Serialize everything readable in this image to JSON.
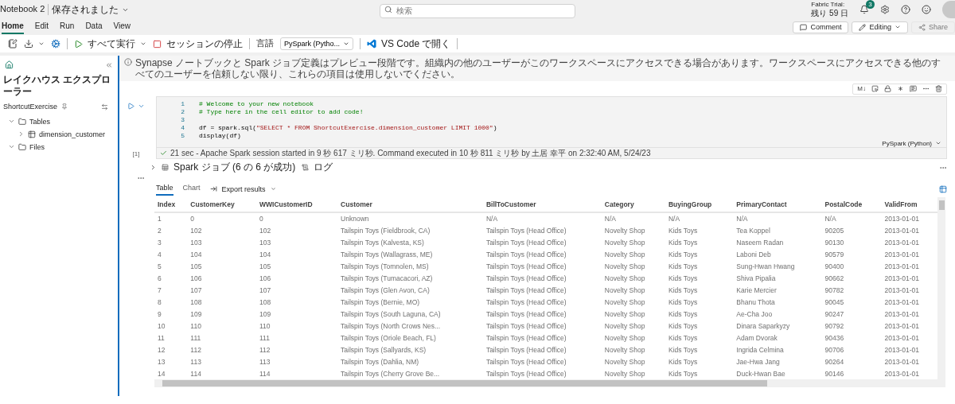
{
  "title_bar": {
    "notebook": "Notebook 2",
    "status": "保存されました",
    "search": {
      "placeholder": "検索"
    },
    "trial_label": "Fabric Trial:",
    "trial_remaining": "残り 59 日",
    "notification_count": "3"
  },
  "menu_tabs": [
    {
      "label": "Home",
      "selected": true
    },
    {
      "label": "Edit",
      "selected": false
    },
    {
      "label": "Run",
      "selected": false
    },
    {
      "label": "Data",
      "selected": false
    },
    {
      "label": "View",
      "selected": false
    }
  ],
  "actions": [
    {
      "kind": "comment",
      "label": "Comment",
      "disabled": false
    },
    {
      "kind": "editing",
      "label": "Editing",
      "disabled": false
    },
    {
      "kind": "share",
      "label": "Share",
      "disabled": true
    }
  ],
  "toolbar": {
    "run_all": "すべて実行",
    "stop_session": "セッションの停止",
    "language_label": "言語",
    "language": "PySpark (Pytho...",
    "vscode": "VS Code で開く"
  },
  "banner": "Synapse ノートブックと Spark ジョブ定義はプレビュー段階です。組織内の他のユーザーがこのワークスペースにアクセスできる場合があります。ワークスペースにアクセスできる他のすべてのユーザーを信頼しない限り、これらの項目は使用しないでください。",
  "sidebar": {
    "title": "レイクハウス エクスプローラー",
    "lakehouse": "ShortcutExercise",
    "tree": [
      {
        "kind": "folder",
        "label": "Tables",
        "expanded": true,
        "children": [
          {
            "kind": "table",
            "label": "dimension_customer",
            "expanded": false
          }
        ]
      },
      {
        "kind": "folder",
        "label": "Files",
        "expanded": true
      }
    ]
  },
  "cell": {
    "markdown_tool": "M↓",
    "lines": [
      {
        "number": "1",
        "kind": "comment",
        "code": "# Welcome to your new notebook"
      },
      {
        "number": "2",
        "kind": "comment",
        "code": "# Type here in the cell editor to add code!"
      },
      {
        "number": "3",
        "kind": "blank"
      },
      {
        "number": "4",
        "kind": "code",
        "code": "df = spark.sql(",
        "string": "\"SELECT * FROM ShortcutExercise.dimension_customer LIMIT 1000\"",
        "tail": ")"
      },
      {
        "number": "5",
        "kind": "code",
        "code": "display(df)"
      }
    ],
    "execution_count": "[1]",
    "status": "21 sec - Apache Spark session started in 9 秒 617 ミリ秒. Command executed in 10 秒 811 ミリ秒 by 土居 幸平 on 2:32:40 AM, 5/24/23",
    "language": "PySpark (Python)"
  },
  "jobs": {
    "label": "Spark ジョブ (6 の 6 が成功)",
    "log": "ログ"
  },
  "output": {
    "tabs": [
      {
        "label": "Table",
        "selected": true
      },
      {
        "label": "Chart",
        "selected": false
      }
    ],
    "export": "Export results",
    "table": {
      "columns": [
        "Index",
        "CustomerKey",
        "WWICustomerID",
        "Customer",
        "BillToCustomer",
        "Category",
        "BuyingGroup",
        "PrimaryContact",
        "PostalCode",
        "ValidFrom"
      ],
      "rows": [
        [
          "1",
          "0",
          "0",
          "Unknown",
          "N/A",
          "N/A",
          "N/A",
          "N/A",
          "N/A",
          "2013-01-01"
        ],
        [
          "2",
          "102",
          "102",
          "Tailspin Toys (Fieldbrook, CA)",
          "Tailspin Toys (Head Office)",
          "Novelty Shop",
          "Kids Toys",
          "Tea Koppel",
          "90205",
          "2013-01-01"
        ],
        [
          "3",
          "103",
          "103",
          "Tailspin Toys (Kalvesta, KS)",
          "Tailspin Toys (Head Office)",
          "Novelty Shop",
          "Kids Toys",
          "Naseem Radan",
          "90130",
          "2013-01-01"
        ],
        [
          "4",
          "104",
          "104",
          "Tailspin Toys (Wallagrass, ME)",
          "Tailspin Toys (Head Office)",
          "Novelty Shop",
          "Kids Toys",
          "Laboni Deb",
          "90579",
          "2013-01-01"
        ],
        [
          "5",
          "105",
          "105",
          "Tailspin Toys (Tomnolen, MS)",
          "Tailspin Toys (Head Office)",
          "Novelty Shop",
          "Kids Toys",
          "Sung-Hwan Hwang",
          "90400",
          "2013-01-01"
        ],
        [
          "6",
          "106",
          "106",
          "Tailspin Toys (Tumacacori, AZ)",
          "Tailspin Toys (Head Office)",
          "Novelty Shop",
          "Kids Toys",
          "Shiva Pipalia",
          "90662",
          "2013-01-01"
        ],
        [
          "7",
          "107",
          "107",
          "Tailspin Toys (Glen Avon, CA)",
          "Tailspin Toys (Head Office)",
          "Novelty Shop",
          "Kids Toys",
          "Karie Mercier",
          "90782",
          "2013-01-01"
        ],
        [
          "8",
          "108",
          "108",
          "Tailspin Toys (Bernie, MO)",
          "Tailspin Toys (Head Office)",
          "Novelty Shop",
          "Kids Toys",
          "Bhanu Thota",
          "90045",
          "2013-01-01"
        ],
        [
          "9",
          "109",
          "109",
          "Tailspin Toys (South Laguna, CA)",
          "Tailspin Toys (Head Office)",
          "Novelty Shop",
          "Kids Toys",
          "Ae-Cha Joo",
          "90247",
          "2013-01-01"
        ],
        [
          "10",
          "110",
          "110",
          "Tailspin Toys (North Crows Nes...",
          "Tailspin Toys (Head Office)",
          "Novelty Shop",
          "Kids Toys",
          "Dinara Saparkyzy",
          "90792",
          "2013-01-01"
        ],
        [
          "11",
          "111",
          "111",
          "Tailspin Toys (Oriole Beach, FL)",
          "Tailspin Toys (Head Office)",
          "Novelty Shop",
          "Kids Toys",
          "Adam Dvorak",
          "90436",
          "2013-01-01"
        ],
        [
          "12",
          "112",
          "112",
          "Tailspin Toys (Sallyards, KS)",
          "Tailspin Toys (Head Office)",
          "Novelty Shop",
          "Kids Toys",
          "Ingrida Celmina",
          "90706",
          "2013-01-01"
        ],
        [
          "13",
          "113",
          "113",
          "Tailspin Toys (Dahlia, NM)",
          "Tailspin Toys (Head Office)",
          "Novelty Shop",
          "Kids Toys",
          "Jae-Hwa Jang",
          "90264",
          "2013-01-01"
        ],
        [
          "14",
          "114",
          "114",
          "Tailspin Toys (Cherry Grove Be...",
          "Tailspin Toys (Head Office)",
          "Novelty Shop",
          "Kids Toys",
          "Duck-Hwan Bae",
          "90146",
          "2013-01-01"
        ]
      ]
    }
  }
}
